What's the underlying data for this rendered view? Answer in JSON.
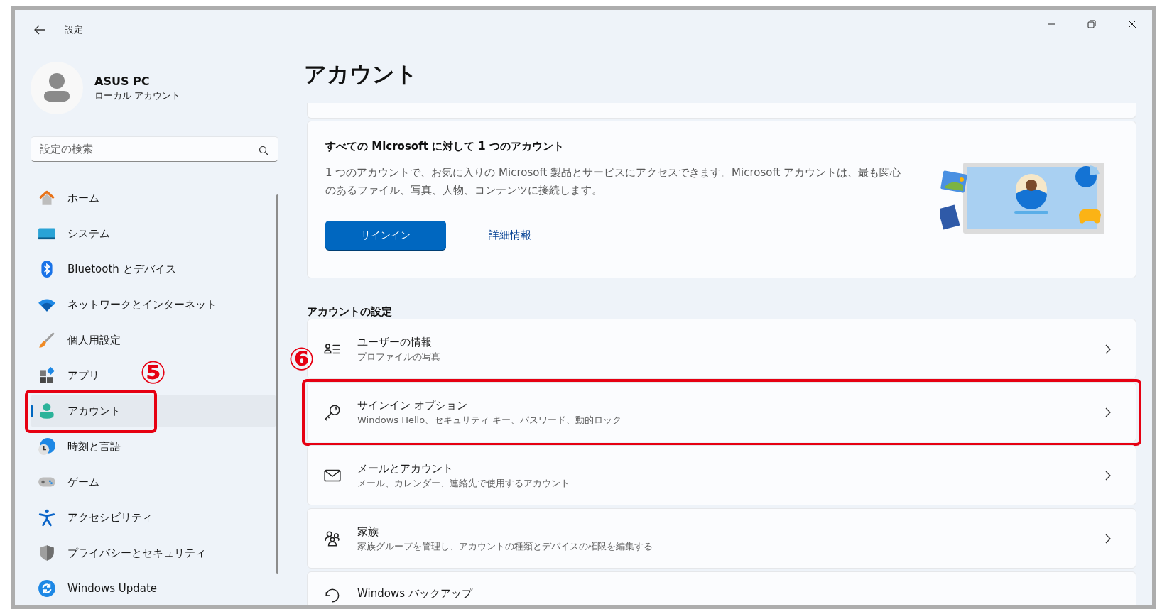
{
  "window": {
    "title": "設定"
  },
  "profile": {
    "name": "ASUS PC",
    "account_type": "ローカル アカウント"
  },
  "search": {
    "placeholder": "設定の検索"
  },
  "nav": [
    {
      "label": "ホーム",
      "selected": false
    },
    {
      "label": "システム",
      "selected": false
    },
    {
      "label": "Bluetooth とデバイス",
      "selected": false
    },
    {
      "label": "ネットワークとインターネット",
      "selected": false
    },
    {
      "label": "個人用設定",
      "selected": false
    },
    {
      "label": "アプリ",
      "selected": false
    },
    {
      "label": "アカウント",
      "selected": true,
      "callout": "⑤"
    },
    {
      "label": "時刻と言語",
      "selected": false
    },
    {
      "label": "ゲーム",
      "selected": false
    },
    {
      "label": "アクセシビリティ",
      "selected": false
    },
    {
      "label": "プライバシーとセキュリティ",
      "selected": false
    },
    {
      "label": "Windows Update",
      "selected": false
    }
  ],
  "page_title": "アカウント",
  "promo": {
    "title": "すべての Microsoft に対して 1 つのアカウント",
    "body": "1 つのアカウントで、お気に入りの Microsoft 製品とサービスにアクセスできます。Microsoft アカウントは、最も関心のあるファイル、写真、人物、コンテンツに接続します。",
    "primary_button": "サインイン",
    "link": "詳細情報"
  },
  "section_title": "アカウントの設定",
  "settings": [
    {
      "title": "ユーザーの情報",
      "subtitle": "プロファイルの写真"
    },
    {
      "title": "サインイン オプション",
      "subtitle": "Windows Hello、セキュリティ キー、パスワード、動的ロック",
      "callout": "⑥"
    },
    {
      "title": "メールとアカウント",
      "subtitle": "メール、カレンダー、連絡先で使用するアカウント"
    },
    {
      "title": "家族",
      "subtitle": "家族グループを管理し、アカウントの種類とデバイスの権限を編集する"
    },
    {
      "title": "Windows バックアップ"
    }
  ]
}
